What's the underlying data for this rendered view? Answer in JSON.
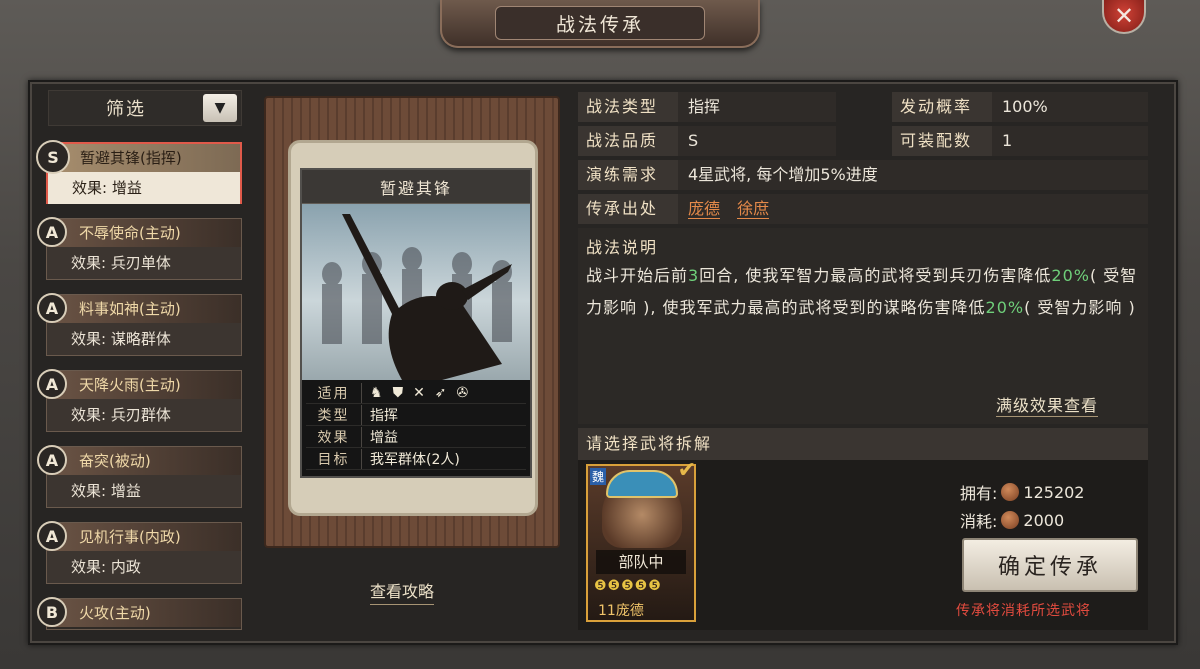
{
  "header": {
    "title": "战法传承",
    "close_label": "✕"
  },
  "filter": {
    "label": "筛选",
    "dropdown_glyph": "▼"
  },
  "skills": [
    {
      "grade": "S",
      "name": "暂避其锋(指挥)",
      "effect": "效果: 增益",
      "selected": true
    },
    {
      "grade": "A",
      "name": "不辱使命(主动)",
      "effect": "效果: 兵刃单体"
    },
    {
      "grade": "A",
      "name": "料事如神(主动)",
      "effect": "效果: 谋略群体"
    },
    {
      "grade": "A",
      "name": "天降火雨(主动)",
      "effect": "效果: 兵刃群体"
    },
    {
      "grade": "A",
      "name": "奋突(被动)",
      "effect": "效果: 增益"
    },
    {
      "grade": "A",
      "name": "见机行事(内政)",
      "effect": "效果: 内政"
    },
    {
      "grade": "B",
      "name": "火攻(主动)",
      "effect": ""
    }
  ],
  "card": {
    "title": "暂避其锋",
    "rows": [
      {
        "key": "适用",
        "value": ""
      },
      {
        "key": "类型",
        "value": "指挥"
      },
      {
        "key": "效果",
        "value": "增益"
      },
      {
        "key": "目标",
        "value": "我军群体(2人)"
      }
    ],
    "troop_icons": [
      "horse-icon",
      "shield-icon",
      "crossed-bows-icon",
      "spear-icon",
      "wheel-icon"
    ]
  },
  "guide_label": "查看攻略",
  "info": {
    "type_label": "战法类型",
    "type_value": "指挥",
    "rate_label": "发动概率",
    "rate_value": "100%",
    "quality_label": "战法品质",
    "quality_value": "S",
    "slots_label": "可装配数",
    "slots_value": "1",
    "drill_label": "演练需求",
    "drill_value": "4星武将, 每个增加5%进度",
    "source_label": "传承出处",
    "source_1": "庞德",
    "source_2": "徐庶"
  },
  "description": {
    "title": "战法说明",
    "p1": "战斗开始后前",
    "n1": "3",
    "p2": "回合, 使我军智力最高的武将受到兵刃伤害降低",
    "n2": "20%",
    "p3": "( 受智力影响 ), 使我军武力最高的武将受到的谋略伤害降低",
    "n3": "20%",
    "p4": "( 受智力影响 )"
  },
  "full_effect_label": "满级效果查看",
  "pick": {
    "title": "请选择武将拆解",
    "general": {
      "faction": "魏",
      "troop": "部队中",
      "stars": "❺❺❺❺❺",
      "name": "11庞德"
    }
  },
  "resources": {
    "own_label": "拥有:",
    "own_value": "125202",
    "cost_label": "消耗:",
    "cost_value": "2000"
  },
  "confirm_label": "确定传承",
  "warning": "传承将消耗所选武将",
  "colors": {
    "accent_orange": "#e58a4a",
    "highlight_green": "#6fcf7a",
    "warning_red": "#e24b3f"
  }
}
